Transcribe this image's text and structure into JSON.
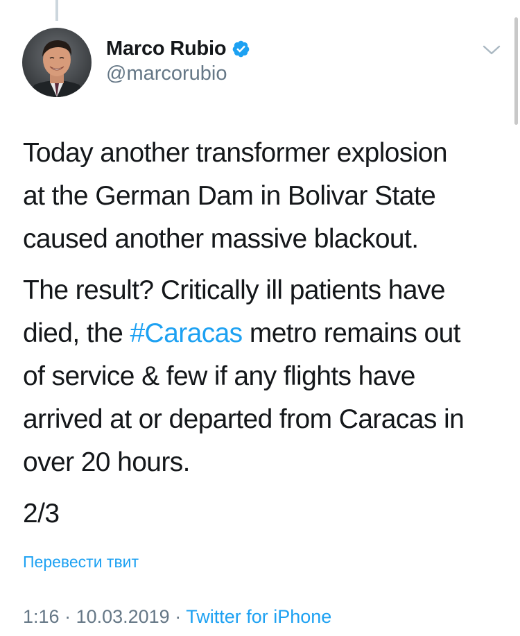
{
  "tweet": {
    "author": {
      "display_name": "Marco Rubio",
      "handle": "@marcorubio",
      "verified": true
    },
    "paragraphs": [
      {
        "lines": [
          "Today another transformer explosion",
          "at the German Dam in Bolivar State",
          "caused another massive blackout."
        ]
      }
    ],
    "paragraph2": {
      "line1": "The result? Critically ill patients have",
      "line2_before": "died, the ",
      "line2_hashtag": "#Caracas",
      "line2_after": " metro remains out",
      "line3": "of service & few if any flights have",
      "line4": "arrived at or departed from Caracas in",
      "line5": "over 20 hours."
    },
    "thread_position": "2/3",
    "translate_label": "Перевести твит",
    "time": "1:16",
    "separator": " · ",
    "date": "10.03.2019",
    "source": "Twitter for iPhone"
  },
  "colors": {
    "link": "#1da1f2",
    "secondary_text": "#657786",
    "primary_text": "#14171a",
    "thread_line": "#ccd6dd"
  },
  "icons": {
    "verified": "verified-badge-icon",
    "caret": "chevron-down-icon"
  }
}
